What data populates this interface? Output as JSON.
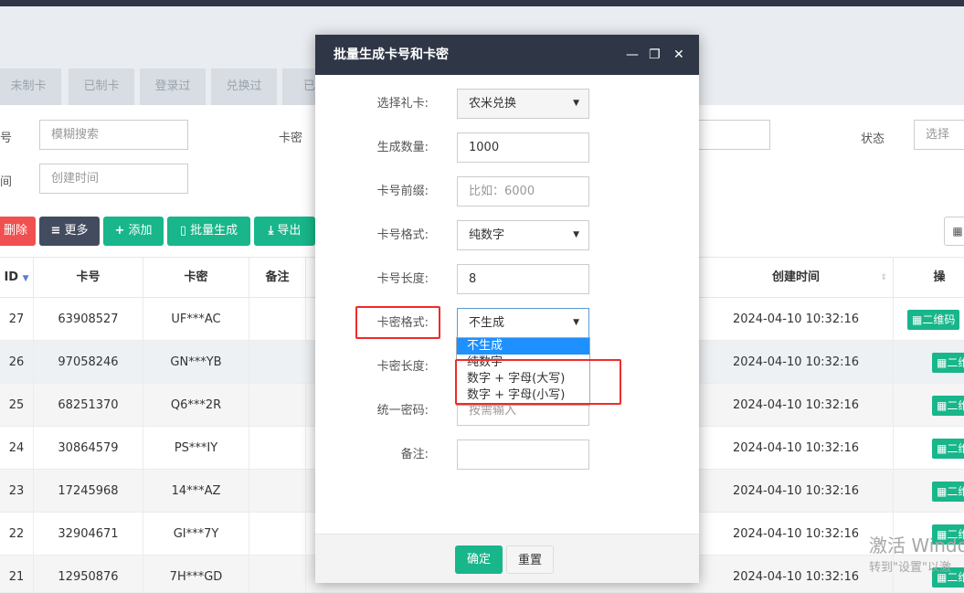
{
  "tabs": [
    "未制卡",
    "已制卡",
    "登录过",
    "兑换过",
    "已失"
  ],
  "filters": {
    "card_no_label": "号",
    "card_no_placeholder": "模糊搜索",
    "card_pwd_label": "卡密",
    "time_label": "间",
    "time_placeholder": "创建时间",
    "status_label": "状态",
    "status_value": "选择"
  },
  "toolbar": {
    "delete": "删除",
    "more": "更多",
    "add": "添加",
    "batch": "批量生成",
    "export": "导出",
    "grid": "▦"
  },
  "table": {
    "headers": [
      "ID",
      "卡号",
      "卡密",
      "备注",
      "创建时间",
      "操"
    ],
    "rows": [
      {
        "id": "27",
        "card_no": "63908527",
        "card_pwd": "UF***AC",
        "time": "2024-04-10 10:32:16",
        "action": "二维码"
      },
      {
        "id": "26",
        "card_no": "97058246",
        "card_pwd": "GN***YB",
        "time": "2024-04-10 10:32:16",
        "action": "二维"
      },
      {
        "id": "25",
        "card_no": "68251370",
        "card_pwd": "Q6***2R",
        "time": "2024-04-10 10:32:16",
        "action": "二维"
      },
      {
        "id": "24",
        "card_no": "30864579",
        "card_pwd": "PS***IY",
        "time": "2024-04-10 10:32:16",
        "action": "二维"
      },
      {
        "id": "23",
        "card_no": "17245968",
        "card_pwd": "14***AZ",
        "time": "2024-04-10 10:32:16",
        "action": "二维"
      },
      {
        "id": "22",
        "card_no": "32904671",
        "card_pwd": "GI***7Y",
        "time": "2024-04-10 10:32:16",
        "action": "二维"
      },
      {
        "id": "21",
        "card_no": "12950876",
        "card_pwd": "7H***GD",
        "time": "2024-04-10 10:32:16",
        "action": "二维"
      }
    ]
  },
  "dialog": {
    "title": "批量生成卡号和卡密",
    "minimize": "—",
    "maximize": "❐",
    "close": "✕",
    "gift_label": "选择礼卡:",
    "gift_value": "农米兑换",
    "qty_label": "生成数量:",
    "qty_value": "1000",
    "prefix_label": "卡号前缀:",
    "prefix_placeholder": "比如：6000",
    "no_format_label": "卡号格式:",
    "no_format_value": "纯数字",
    "no_length_label": "卡号长度:",
    "no_length_value": "8",
    "pwd_format_label": "卡密格式:",
    "pwd_format_value": "不生成",
    "pwd_format_options": [
      "不生成",
      "纯数字",
      "数字 + 字母(大写)",
      "数字 + 字母(小写)"
    ],
    "pwd_length_label": "卡密长度:",
    "unified_pwd_label": "统一密码:",
    "unified_pwd_placeholder": "按需输入",
    "remark_label": "备注:",
    "confirm": "确定",
    "reset": "重置"
  },
  "watermark": {
    "line1": "激活 Windo",
    "line2": "转到\"设置\"以激"
  }
}
